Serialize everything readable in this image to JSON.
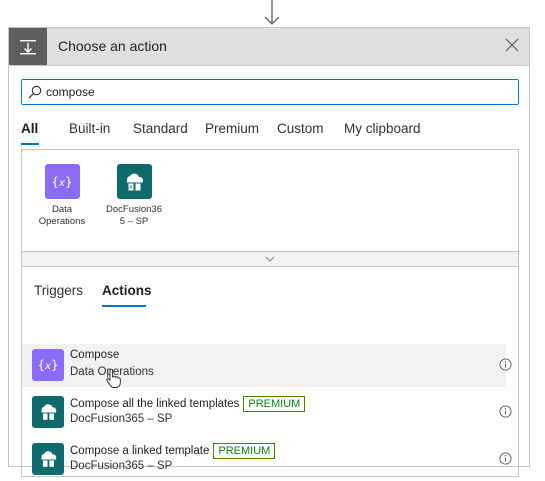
{
  "header": {
    "title": "Choose an action",
    "icon": "action-step-icon",
    "close_icon": "close-icon"
  },
  "search": {
    "value": "compose",
    "placeholder": "",
    "icon": "search-icon"
  },
  "tabs": [
    {
      "label": "All",
      "active": true
    },
    {
      "label": "Built-in",
      "active": false
    },
    {
      "label": "Standard",
      "active": false
    },
    {
      "label": "Premium",
      "active": false
    },
    {
      "label": "Custom",
      "active": false
    },
    {
      "label": "My clipboard",
      "active": false
    }
  ],
  "connectors": [
    {
      "label_line1": "Data",
      "label_line2": "Operations",
      "icon": "data-operations-icon",
      "color": "#8c6cf7"
    },
    {
      "label_line1": "DocFusion36",
      "label_line2": "5 – SP",
      "icon": "docfusion-icon",
      "color": "#0f6b6b"
    }
  ],
  "expander": {
    "icon": "chevron-down-icon"
  },
  "subtabs": [
    {
      "label": "Triggers",
      "active": false
    },
    {
      "label": "Actions",
      "active": true
    }
  ],
  "actions": [
    {
      "title": "Compose",
      "subtitle": "Data Operations",
      "badge": "",
      "icon": "data-operations-icon",
      "color": "#8c6cf7",
      "hover": true
    },
    {
      "title": "Compose all the linked templates",
      "subtitle": "DocFusion365 – SP",
      "badge": "PREMIUM",
      "icon": "docfusion-icon",
      "color": "#0f6b6b",
      "hover": false
    },
    {
      "title": "Compose a linked template",
      "subtitle": "DocFusion365 – SP",
      "badge": "PREMIUM",
      "icon": "docfusion-icon",
      "color": "#0f6b6b",
      "hover": false
    }
  ],
  "colors": {
    "accent": "#0078d4",
    "premium": "#107c10",
    "header_bg": "#e1dfdd",
    "header_icon_bg": "#605e5c"
  }
}
